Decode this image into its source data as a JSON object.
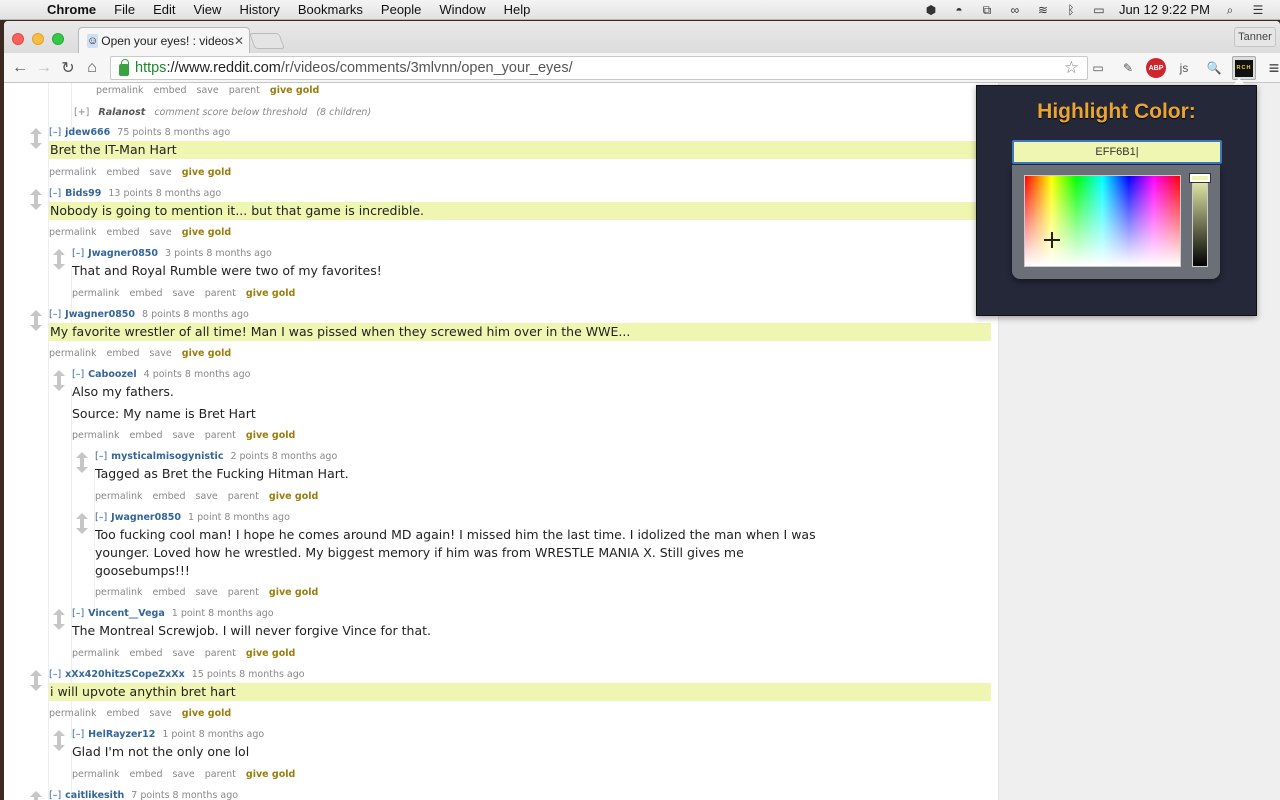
{
  "menubar": {
    "app": "Chrome",
    "items": [
      "File",
      "Edit",
      "View",
      "History",
      "Bookmarks",
      "People",
      "Window",
      "Help"
    ],
    "clock": "Jun 12  9:22 PM"
  },
  "browser": {
    "tab_title": "Open your eyes! : videos",
    "profile": "Tanner",
    "url_scheme": "https",
    "url_host": "://www.reddit.com",
    "url_path": "/r/videos/comments/3mlvnn/open_your_eyes/",
    "extensions": [
      "cast-icon",
      "eyedropper-icon",
      "ABP",
      "js-icon",
      "search-extension-icon",
      "RCH"
    ]
  },
  "actions": {
    "permalink": "permalink",
    "embed": "embed",
    "save": "save",
    "parent": "parent",
    "give_gold": "give gold",
    "toggle": "[–]",
    "toggle_collapsed": "[+]"
  },
  "collapsed_comment": {
    "author": "Ralanost",
    "note": "comment score below threshold",
    "children": "(8 children)"
  },
  "comments": [
    {
      "author": "jdew666",
      "score": "75 points",
      "age": "8 months ago",
      "body": "Bret the IT-Man Hart",
      "highlighted": true
    },
    {
      "author": "Bids99",
      "score": "13 points",
      "age": "8 months ago",
      "body": "Nobody is going to mention it... but that game is incredible.",
      "highlighted": true
    },
    {
      "author": "Jwagner0850",
      "score": "3 points",
      "age": "8 months ago",
      "body": "That and Royal Rumble were two of my favorites!",
      "highlighted": false
    },
    {
      "author": "Jwagner0850",
      "score": "8 points",
      "age": "8 months ago",
      "body": "My favorite wrestler of all time! Man I was pissed when they screwed him over in the WWE...",
      "highlighted": true
    },
    {
      "author": "Caboozel",
      "score": "4 points",
      "age": "8 months ago",
      "body": "Also my fathers.",
      "body2": "Source: My name is Bret Hart",
      "highlighted": false
    },
    {
      "author": "mysticalmisogynistic",
      "score": "2 points",
      "age": "8 months ago",
      "body": "Tagged as Bret the Fucking Hitman Hart.",
      "highlighted": false
    },
    {
      "author": "Jwagner0850",
      "score": "1 point",
      "age": "8 months ago",
      "body": "Too fucking cool man! I hope he comes around MD again! I missed him the last time. I idolized the man when I was younger. Loved how he wrestled. My biggest memory if him was from WRESTLE MANIA X. Still gives me goosebumps!!!",
      "highlighted": false
    },
    {
      "author": "Vincent__Vega",
      "score": "1 point",
      "age": "8 months ago",
      "body": "The Montreal Screwjob. I will never forgive Vince for that.",
      "highlighted": false
    },
    {
      "author": "xXx420hitzSCopeZxXx",
      "score": "15 points",
      "age": "8 months ago",
      "body": "i will upvote anythin bret hart",
      "highlighted": true
    },
    {
      "author": "HelRayzer12",
      "score": "1 point",
      "age": "8 months ago",
      "body": "Glad I'm not the only one lol",
      "highlighted": false
    },
    {
      "author": "caitlikesith",
      "score": "7 points",
      "age": "8 months ago"
    }
  ],
  "popup": {
    "title": "Highlight Color:",
    "hex_value": "EFF6B1",
    "highlight_color": "#eff6b1"
  }
}
